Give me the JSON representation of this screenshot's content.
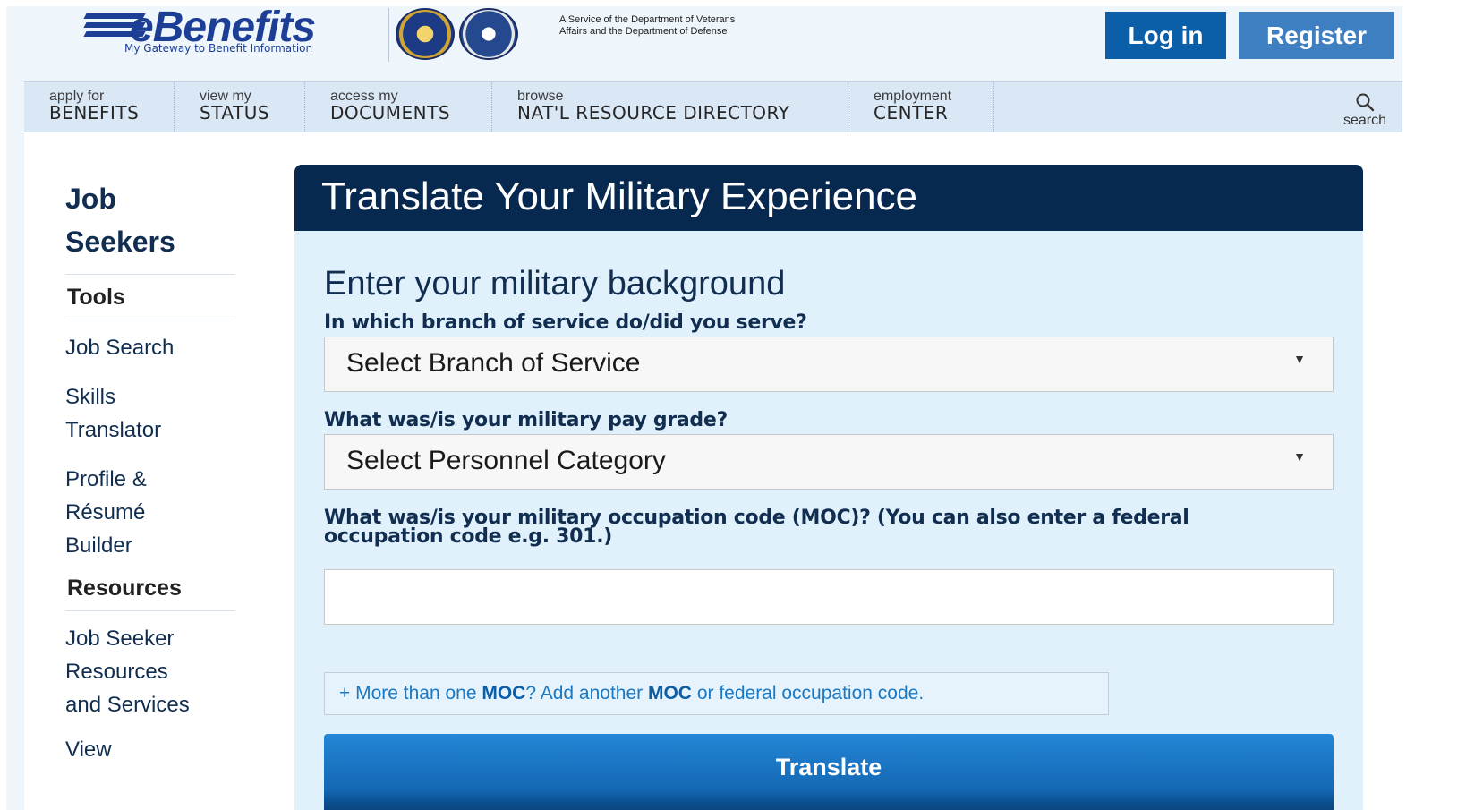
{
  "header": {
    "logo_text": "eBenefits",
    "logo_tagline": "My Gateway to Benefit Information",
    "service_text": "A Service of the Department of Veterans Affairs and the Department of Defense",
    "login_label": "Log in",
    "register_label": "Register"
  },
  "nav": {
    "items": [
      {
        "small": "apply for",
        "big": "BENEFITS"
      },
      {
        "small": "view my",
        "big": "STATUS"
      },
      {
        "small": "access my",
        "big": "DOCUMENTS"
      },
      {
        "small": "browse",
        "big": "NAT'L RESOURCE DIRECTORY"
      },
      {
        "small": "employment",
        "big": "CENTER"
      }
    ],
    "search_label": "search"
  },
  "sidebar": {
    "title_line1": "Job",
    "title_line2": "Seekers",
    "tools_heading": "Tools",
    "links": [
      {
        "lines": [
          "Job Search"
        ]
      },
      {
        "lines": [
          "Skills",
          "Translator"
        ]
      },
      {
        "lines": [
          "Profile &",
          "Résumé",
          "Builder"
        ]
      }
    ],
    "resources_heading": "Resources",
    "resources_links": [
      {
        "lines": [
          "Job Seeker",
          "Resources",
          "and Services"
        ]
      },
      {
        "lines": [
          "View"
        ]
      }
    ]
  },
  "content": {
    "title": "Translate Your Military Experience",
    "section_title": "Enter your military background",
    "q_branch": "In which branch of service do/did you serve?",
    "branch_value": "Select Branch of Service",
    "q_paygrade": "What was/is your military pay grade?",
    "paygrade_value": "Select Personnel Category",
    "q_moc_line1": "What was/is your military occupation code (MOC)? (You can also enter a federal",
    "q_moc_line2": "occupation code e.g. 301.)",
    "moc_value": "",
    "add_moc": {
      "prefix": "+ More than one ",
      "moc1": "MOC",
      "middle": "? Add another ",
      "moc2": "MOC",
      "suffix": " or federal occupation code."
    },
    "translate_label": "Translate"
  }
}
